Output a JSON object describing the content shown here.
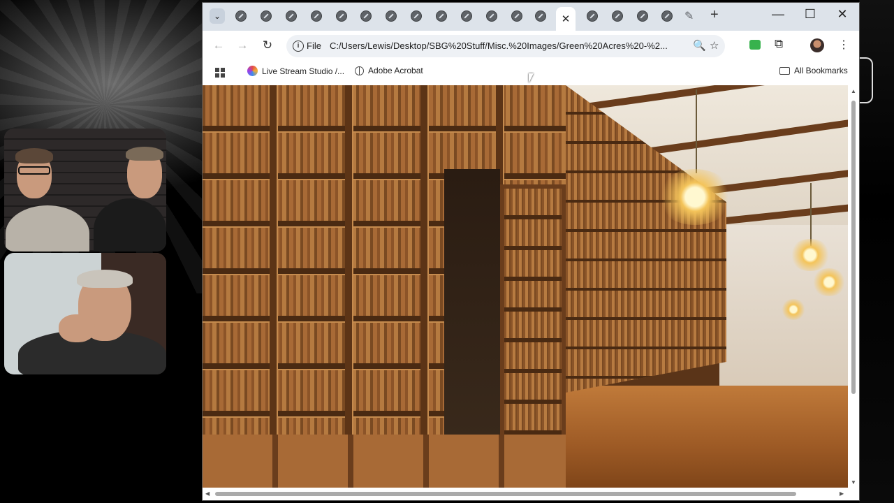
{
  "browser": {
    "tabs_count": 19,
    "active_tab_close": "✕",
    "new_tab": "+",
    "window_controls": {
      "minimize": "—",
      "maximize": "☐",
      "close": "✕"
    },
    "toolbar": {
      "back": "←",
      "forward": "→",
      "reload": "↻",
      "site_info_label": "File",
      "url": "C:/Users/Lewis/Desktop/SBG%20Stuff/Misc.%20Images/Green%20Acres%20-%2...",
      "zoom_icon": "zoom-icon",
      "bookmark_icon": "star-icon",
      "extensions_icon": "puzzle-icon",
      "menu": "⋮"
    },
    "bookmarks": [
      {
        "label": "Live Stream Studio /..."
      },
      {
        "label": "Adobe Acrobat"
      }
    ],
    "all_bookmarks": "All Bookmarks"
  },
  "content": {
    "image_description_icon": "library-image"
  },
  "colors": {
    "tabstrip": "#dde3ea",
    "omnibox": "#eef1f5",
    "wood": "#8c5428"
  }
}
